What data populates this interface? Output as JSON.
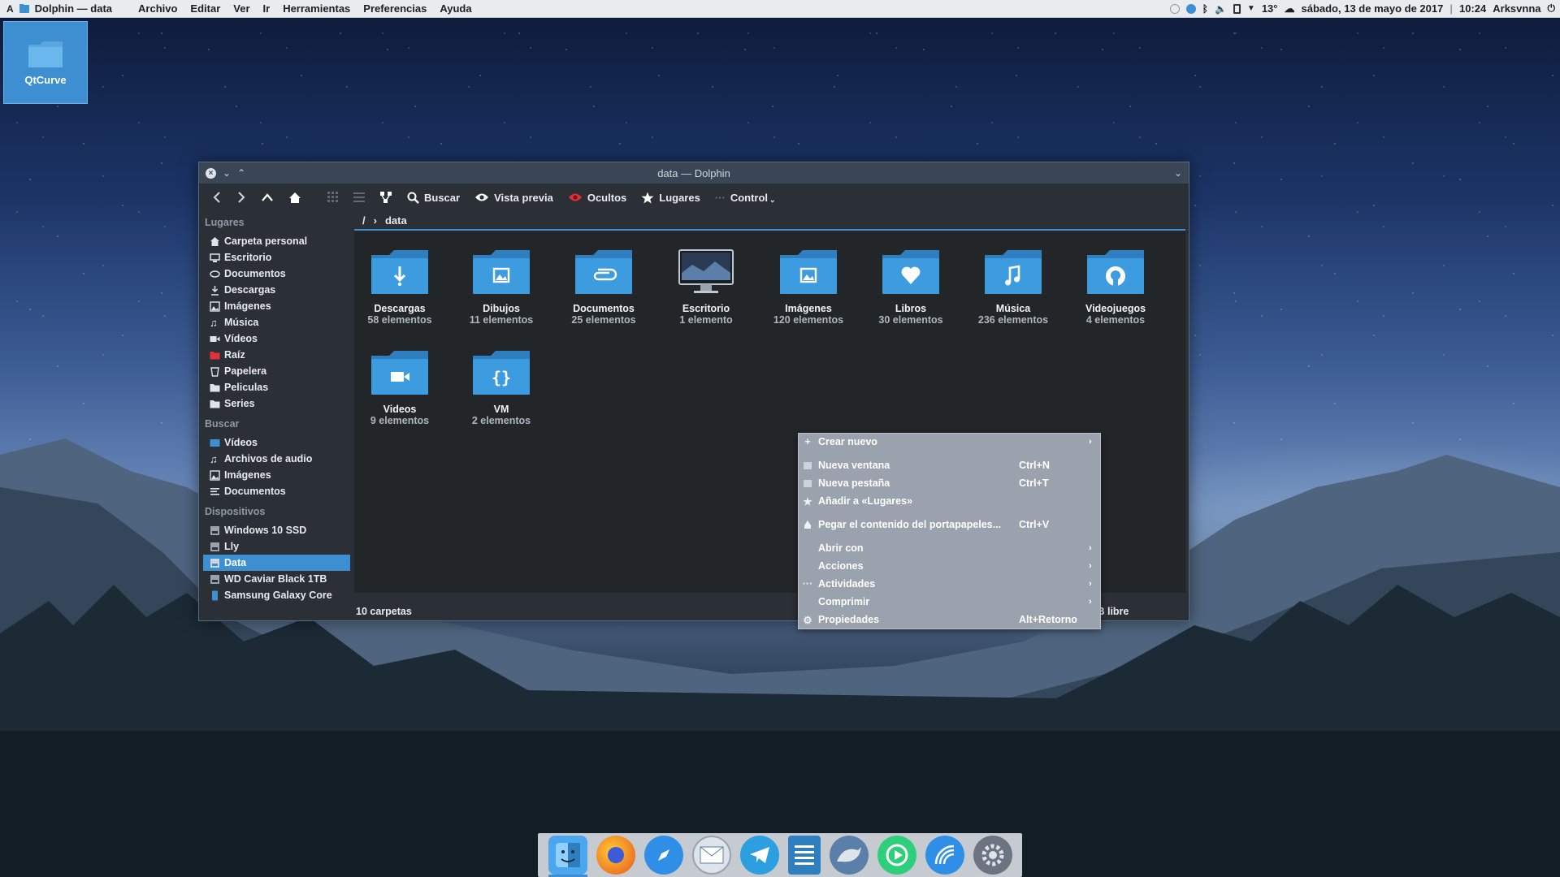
{
  "topbar": {
    "app_title": "Dolphin — data",
    "menus": [
      "Archivo",
      "Editar",
      "Ver",
      "Ir",
      "Herramientas",
      "Preferencias",
      "Ayuda"
    ],
    "temperature": "13°",
    "date": "sábado, 13 de mayo de 2017",
    "time": "10:24",
    "user": "Arksvnna"
  },
  "desktop": {
    "icon_label": "QtCurve"
  },
  "window": {
    "title": "data — Dolphin",
    "toolbar": {
      "search": "Buscar",
      "preview": "Vista previa",
      "hidden": "Ocultos",
      "places": "Lugares",
      "control": "Control"
    },
    "breadcrumb": {
      "root": "/",
      "current": "data"
    },
    "sidebar": {
      "places_header": "Lugares",
      "places": [
        "Carpeta personal",
        "Escritorio",
        "Documentos",
        "Descargas",
        "Imágenes",
        "Música",
        "Vídeos",
        "Raíz",
        "Papelera",
        "Peliculas",
        "Series"
      ],
      "search_header": "Buscar",
      "search": [
        "Vídeos",
        "Archivos de audio",
        "Imágenes",
        "Documentos"
      ],
      "devices_header": "Dispositivos",
      "devices": [
        "Windows 10 SSD",
        "Lly",
        "Data",
        "WD Caviar Black 1TB",
        "Samsung Galaxy Core"
      ]
    },
    "items": [
      {
        "name": "Descargas",
        "count": "58 elementos",
        "icon": "download-folder-icon"
      },
      {
        "name": "Dibujos",
        "count": "11 elementos",
        "icon": "pictures-folder-icon"
      },
      {
        "name": "Documentos",
        "count": "25 elementos",
        "icon": "documents-folder-icon"
      },
      {
        "name": "Escritorio",
        "count": "1 elemento",
        "icon": "desktop-monitor-icon"
      },
      {
        "name": "Imágenes",
        "count": "120 elementos",
        "icon": "images-folder-icon"
      },
      {
        "name": "Libros",
        "count": "30 elementos",
        "icon": "heart-folder-icon"
      },
      {
        "name": "Música",
        "count": "236 elementos",
        "icon": "music-folder-icon"
      },
      {
        "name": "Videojuegos",
        "count": "4 elementos",
        "icon": "github-folder-icon"
      },
      {
        "name": "Videos",
        "count": "9 elementos",
        "icon": "video-folder-icon"
      },
      {
        "name": "VM",
        "count": "2 elementos",
        "icon": "code-folder-icon"
      }
    ],
    "status": {
      "left": "10 carpetas",
      "right": "iB libre"
    }
  },
  "context_menu": [
    {
      "label": "Crear nuevo",
      "shortcut": "",
      "submenu": true,
      "icon": "plus-icon"
    },
    {
      "label": "Nueva ventana",
      "shortcut": "Ctrl+N",
      "submenu": false,
      "icon": "window-icon"
    },
    {
      "label": "Nueva pestaña",
      "shortcut": "Ctrl+T",
      "submenu": false,
      "icon": "tab-icon"
    },
    {
      "label": "Añadir a «Lugares»",
      "shortcut": "",
      "submenu": false,
      "icon": "star-icon"
    },
    {
      "label": "Pegar el contenido del portapapeles...",
      "shortcut": "Ctrl+V",
      "submenu": false,
      "icon": "paste-icon"
    },
    {
      "label": "Abrir con",
      "shortcut": "",
      "submenu": true,
      "icon": ""
    },
    {
      "label": "Acciones",
      "shortcut": "",
      "submenu": true,
      "icon": ""
    },
    {
      "label": "Actividades",
      "shortcut": "",
      "submenu": true,
      "icon": "dots-icon"
    },
    {
      "label": "Comprimir",
      "shortcut": "",
      "submenu": true,
      "icon": ""
    },
    {
      "label": "Propiedades",
      "shortcut": "Alt+Retorno",
      "submenu": false,
      "icon": "gear-icon"
    }
  ],
  "dock": [
    "Finder",
    "Firefox",
    "Safari",
    "Mail",
    "Telegram",
    "Notes",
    "Dolphin",
    "Player",
    "Browser",
    "Settings"
  ],
  "colors": {
    "accent": "#3d8fd1",
    "folder": "#3d8fd1",
    "window_bg": "#232629",
    "menu_bg": "#9aa3ad"
  }
}
